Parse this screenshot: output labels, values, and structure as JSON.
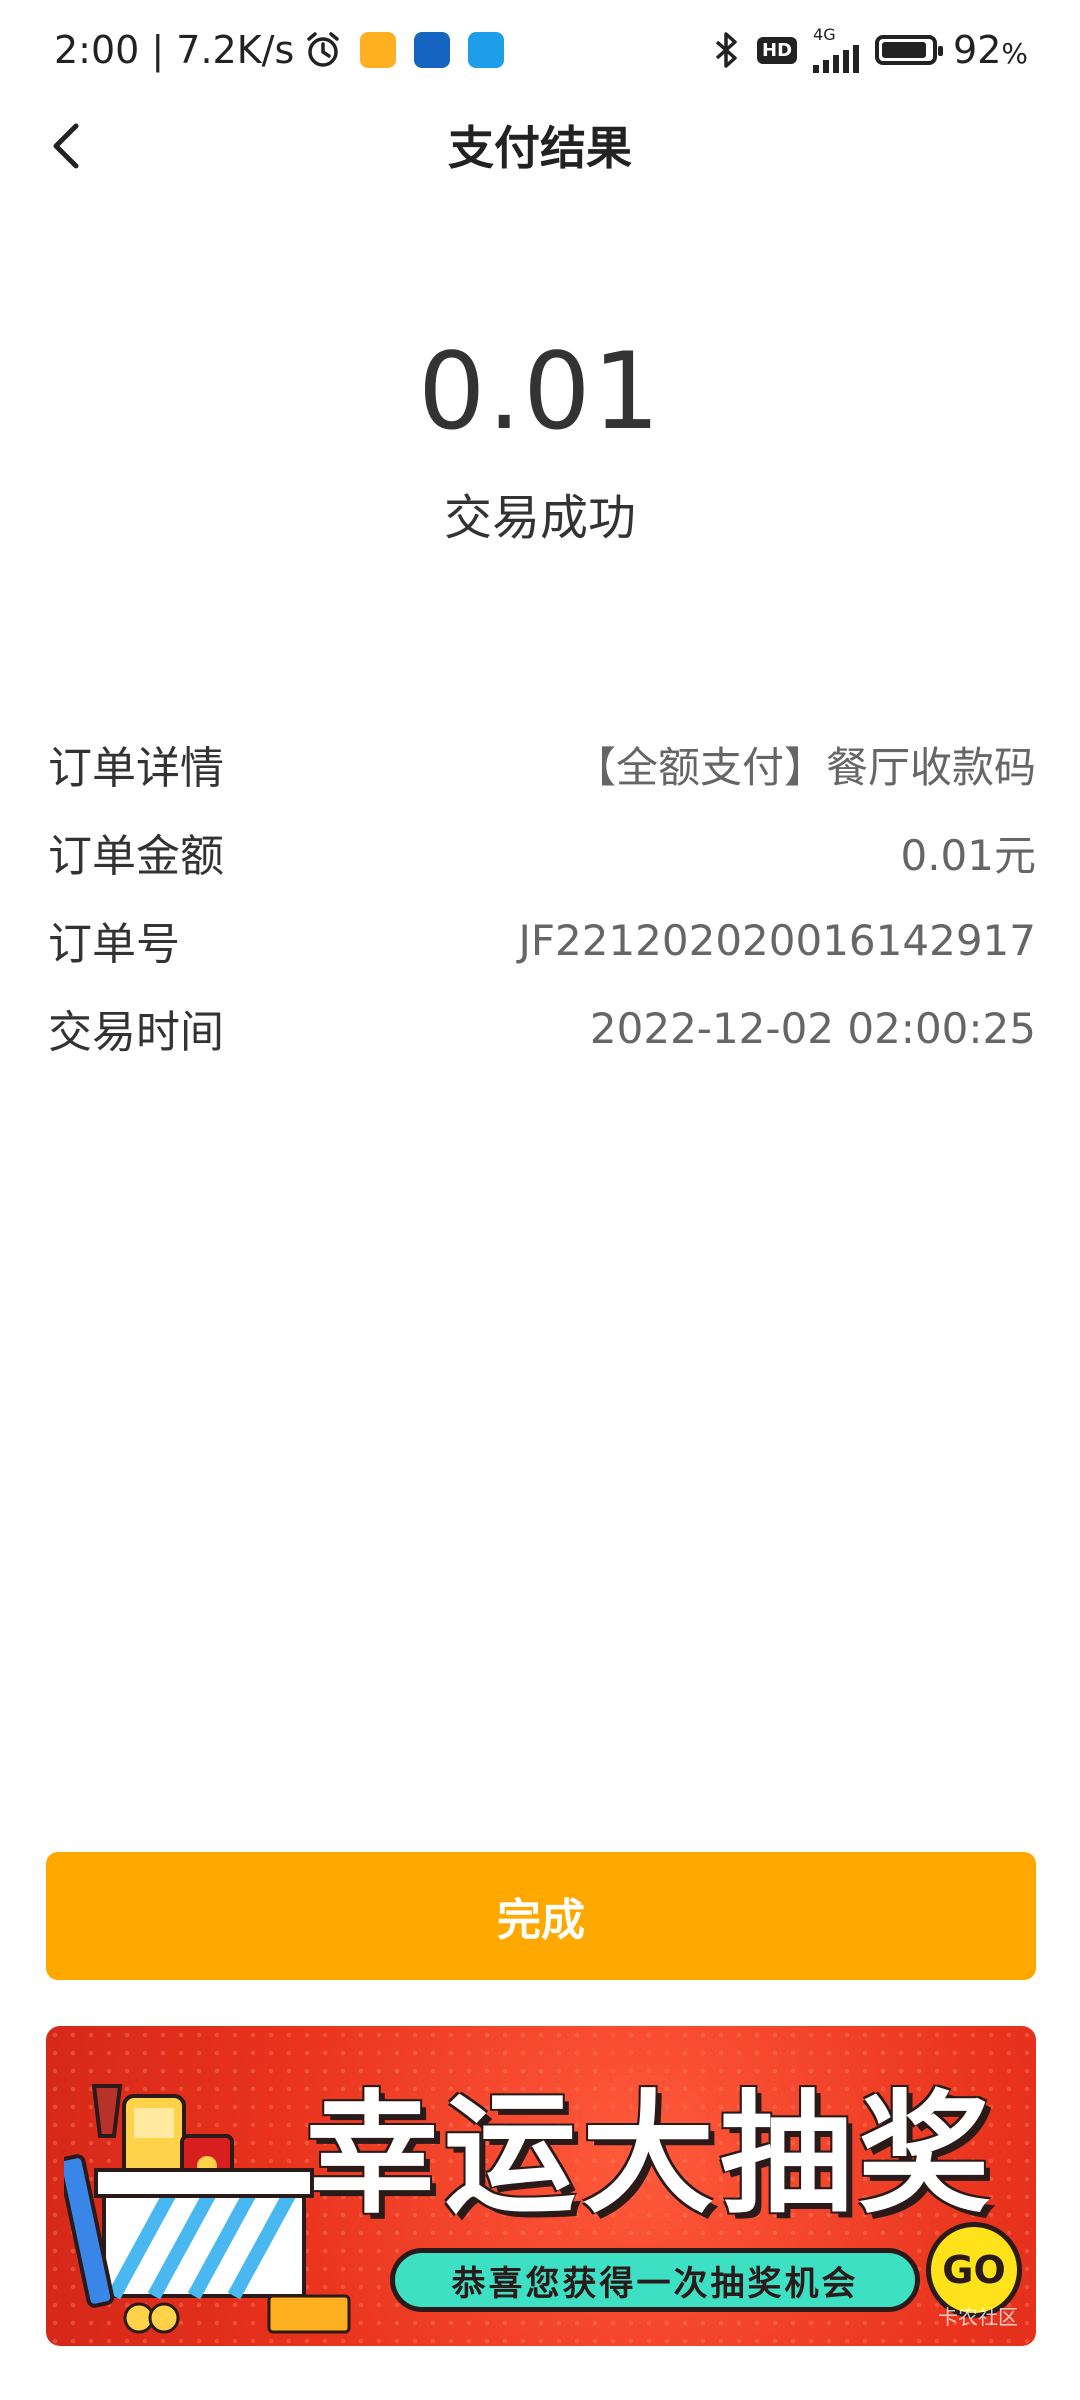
{
  "status_bar": {
    "time_speed": "2:00 | 7.2K/s",
    "network": "4G",
    "hd": "HD",
    "battery": "92",
    "battery_unit": "%",
    "battery_level": 0.92
  },
  "nav": {
    "title": "支付结果"
  },
  "result": {
    "amount": "0.01",
    "status": "交易成功"
  },
  "details": [
    {
      "label": "订单详情",
      "value": "【全额支付】餐厅收款码"
    },
    {
      "label": "订单金额",
      "value": "0.01元"
    },
    {
      "label": "订单号",
      "value": "JF221202020016142917"
    },
    {
      "label": "交易时间",
      "value": "2022-12-02 02:00:25"
    }
  ],
  "done_button": {
    "label": "完成"
  },
  "banner": {
    "title": "幸运大抽奖",
    "subtitle": "恭喜您获得一次抽奖机会",
    "go_label": "GO",
    "watermark": "卡农社区"
  },
  "colors": {
    "accent": "#FFA800",
    "banner_red": "#E8321C",
    "banner_teal": "#3EE0C4"
  }
}
